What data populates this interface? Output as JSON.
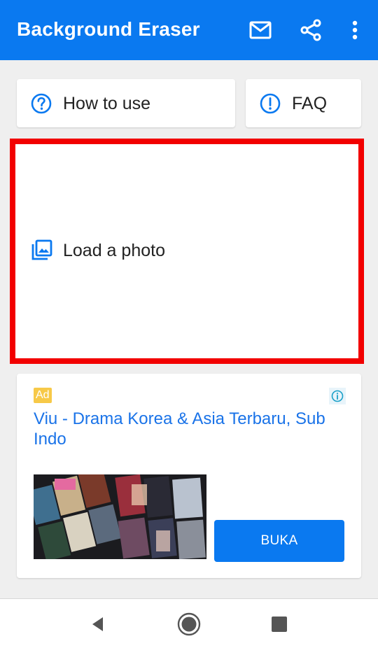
{
  "appbar": {
    "title": "Background Eraser",
    "actions": [
      "mail-icon",
      "share-icon",
      "more-vert-icon"
    ]
  },
  "buttons": {
    "how_to_use": "How to use",
    "faq": "FAQ",
    "load_photo": "Load a photo"
  },
  "ad": {
    "badge": "Ad",
    "headline": "Viu - Drama Korea & Asia Terbaru, Sub Indo",
    "cta": "BUKA"
  },
  "navbar": [
    "back-icon",
    "home-icon",
    "recents-icon"
  ],
  "colors": {
    "primary": "#0a79f0",
    "highlight_border": "#f20000",
    "ad_badge": "#f7c948",
    "link_blue": "#1a73e8"
  }
}
